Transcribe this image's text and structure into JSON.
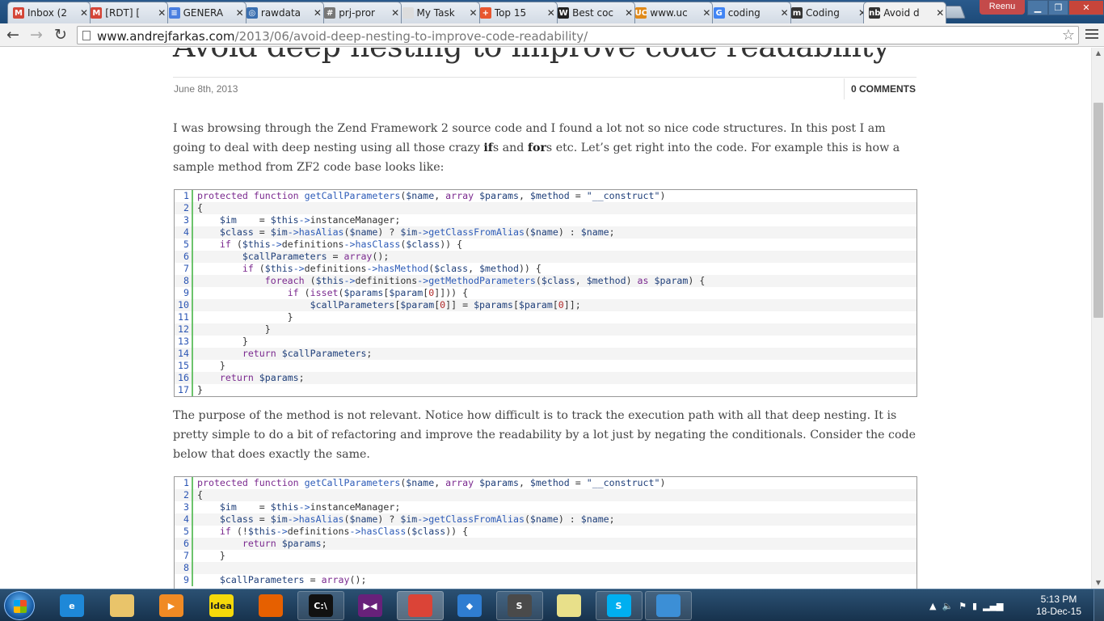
{
  "browser": {
    "tabs": [
      {
        "title": "Inbox (2",
        "icon": "gmail-icon",
        "color": "#d44638",
        "glyph": "M"
      },
      {
        "title": "[RDT] [",
        "icon": "gmail-icon",
        "color": "#d44638",
        "glyph": "M"
      },
      {
        "title": "GENERA",
        "icon": "google-docs-icon",
        "color": "#4a7fe0",
        "glyph": "≡"
      },
      {
        "title": "rawdata",
        "icon": "globe-icon",
        "color": "#3a6fb0",
        "glyph": "◎"
      },
      {
        "title": "prj-pror",
        "icon": "hash-icon",
        "color": "#777777",
        "glyph": "#"
      },
      {
        "title": "My Task",
        "icon": "page-icon",
        "color": "#dddddd",
        "glyph": ""
      },
      {
        "title": "Top 15",
        "icon": "plus-icon",
        "color": "#e8562f",
        "glyph": "+"
      },
      {
        "title": "Best coc",
        "icon": "w-icon",
        "color": "#222222",
        "glyph": "W"
      },
      {
        "title": "www.uc",
        "icon": "uc-icon",
        "color": "#e08a1a",
        "glyph": "UC"
      },
      {
        "title": "coding",
        "icon": "google-icon",
        "color": "#4285f4",
        "glyph": "G"
      },
      {
        "title": "Coding",
        "icon": "medium-icon",
        "color": "#333333",
        "glyph": "m"
      },
      {
        "title": "Avoid d",
        "icon": "nb-icon",
        "color": "#333333",
        "glyph": "nb"
      }
    ],
    "active_tab": 11,
    "profile_name": "Reenu",
    "url_host": "www.andrejfarkas.com",
    "url_path": "/2013/06/avoid-deep-nesting-to-improve-code-readability/"
  },
  "post": {
    "title": "Avoid deep nesting to improve code readability",
    "date": "June 8th, 2013",
    "comments": "0 COMMENTS",
    "para1": {
      "a": "I was browsing through the Zend Framework 2 source code and I found a lot not so nice code structures. In this post I am going to deal with deep nesting using all those crazy ",
      "b1": "if",
      "c": "s and ",
      "b2": "for",
      "d": "s etc. Let’s get right into the code. For example this is how a sample method from ZF2 code base looks like:"
    },
    "para2": "The purpose of the method is not relevant. Notice how difficult is to track the execution path with all that deep nesting. It is pretty simple to do a bit of refactoring and improve the readability by a lot just by negating the conditionals. Consider the code below that does exactly the same.",
    "code1": [
      "protected function getCallParameters($name, array $params, $method = \"__construct\")",
      "{",
      "    $im    = $this->instanceManager;",
      "    $class = $im->hasAlias($name) ? $im->getClassFromAlias($name) : $name;",
      "    if ($this->definitions->hasClass($class)) {",
      "        $callParameters = array();",
      "        if ($this->definitions->hasMethod($class, $method)) {",
      "            foreach ($this->definitions->getMethodParameters($class, $method) as $param) {",
      "                if (isset($params[$param[0]])) {",
      "                    $callParameters[$param[0]] = $params[$param[0]];",
      "                }",
      "            }",
      "        }",
      "        return $callParameters;",
      "    }",
      "    return $params;",
      "}"
    ],
    "code2": [
      "protected function getCallParameters($name, array $params, $method = \"__construct\")",
      "{",
      "    $im    = $this->instanceManager;",
      "    $class = $im->hasAlias($name) ? $im->getClassFromAlias($name) : $name;",
      "    if (!$this->definitions->hasClass($class)) {",
      "        return $params;",
      "    }",
      "",
      "    $callParameters = array();"
    ]
  },
  "taskbar": {
    "apps": [
      {
        "name": "internet-explorer-icon",
        "label": "e",
        "color": "#1e88d8",
        "running": false
      },
      {
        "name": "file-explorer-icon",
        "label": "",
        "color": "#e9c46a",
        "running": false
      },
      {
        "name": "media-player-icon",
        "label": "▶",
        "color": "#f08a24",
        "running": false
      },
      {
        "name": "idea-app-icon",
        "label": "Idea",
        "color": "#f5d90a",
        "running": false
      },
      {
        "name": "firefox-icon",
        "label": "",
        "color": "#e66000",
        "running": false
      },
      {
        "name": "command-prompt-icon",
        "label": "C:\\",
        "color": "#111111",
        "running": true
      },
      {
        "name": "visual-studio-icon",
        "label": "▶◀",
        "color": "#68217a",
        "running": false
      },
      {
        "name": "chrome-icon",
        "label": "",
        "color": "#db4437",
        "running": true,
        "active": true
      },
      {
        "name": "sourcetree-icon",
        "label": "◆",
        "color": "#2f7dd1",
        "running": false
      },
      {
        "name": "sublime-text-icon",
        "label": "S",
        "color": "#4a4a4a",
        "running": true
      },
      {
        "name": "sticky-notes-icon",
        "label": "",
        "color": "#e8e08a",
        "running": false
      },
      {
        "name": "skype-icon",
        "label": "S",
        "color": "#00aff0",
        "running": true
      },
      {
        "name": "photo-viewer-icon",
        "label": "",
        "color": "#3c8fd6",
        "running": true
      }
    ],
    "time": "5:13 PM",
    "date": "18-Dec-15"
  }
}
